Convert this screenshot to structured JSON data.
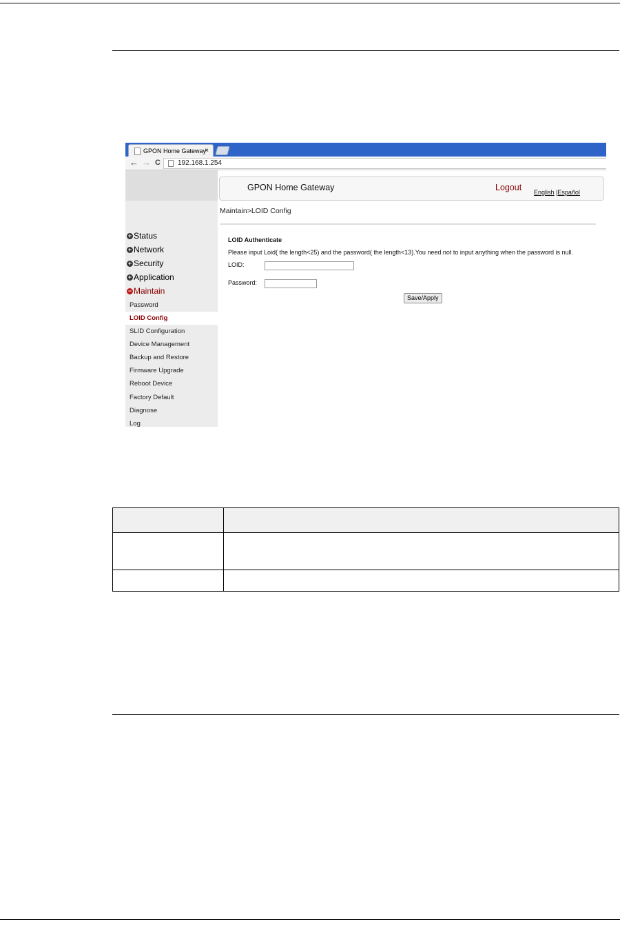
{
  "browser": {
    "tab_title": "GPON Home Gateway",
    "tab_close": "×",
    "url": "192.168.1.254",
    "back": "←",
    "forward": "→",
    "reload": "C"
  },
  "header": {
    "brand": "GPON Home Gateway",
    "logout": "Logout",
    "lang_english": "English",
    "lang_sep": " |",
    "lang_espanol": "Español"
  },
  "sidebar": {
    "menus": [
      {
        "label": "Status"
      },
      {
        "label": "Network"
      },
      {
        "label": "Security"
      },
      {
        "label": "Application"
      },
      {
        "label": "Maintain"
      }
    ],
    "submenu": [
      {
        "label": "Password"
      },
      {
        "label": "LOID Config"
      },
      {
        "label": "SLID Configuration"
      },
      {
        "label": "Device Management"
      },
      {
        "label": "Backup and Restore"
      },
      {
        "label": "Firmware Upgrade"
      },
      {
        "label": "Reboot Device"
      },
      {
        "label": "Factory Default"
      },
      {
        "label": "Diagnose"
      },
      {
        "label": "Log"
      }
    ]
  },
  "content": {
    "breadcrumb": "Maintain>LOID Config",
    "section_title": "LOID Authenticate",
    "hint": "Please input Loid( the length<25) and the password( the length<13).You need not to input anything when the password is null.",
    "loid_label": "LOID:",
    "loid_value": "",
    "password_label": "Password:",
    "password_value": "",
    "save_button": "Save/Apply"
  },
  "table": {
    "rows": [
      {
        "col1": "",
        "col2": ""
      },
      {
        "col1": "",
        "col2": ""
      },
      {
        "col1": "",
        "col2": ""
      }
    ]
  }
}
